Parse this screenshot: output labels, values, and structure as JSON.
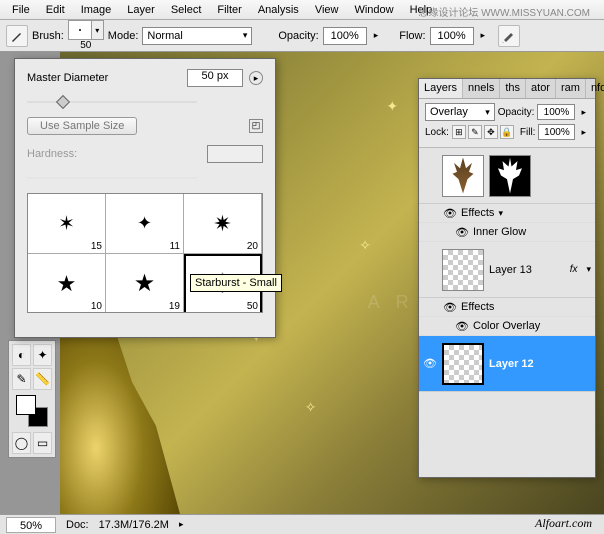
{
  "menu": [
    "File",
    "Edit",
    "Image",
    "Layer",
    "Select",
    "Filter",
    "Analysis",
    "View",
    "Window",
    "Help"
  ],
  "watermark": "思缘设计论坛  WWW.MISSYUAN.COM",
  "options": {
    "brush_label": "Brush:",
    "brush_size": "50",
    "mode_label": "Mode:",
    "mode_value": "Normal",
    "opacity_label": "Opacity:",
    "opacity_value": "100%",
    "flow_label": "Flow:",
    "flow_value": "100%"
  },
  "brush_panel": {
    "diameter_label": "Master Diameter",
    "diameter_value": "50 px",
    "sample_btn": "Use Sample Size",
    "hardness_label": "Hardness:",
    "hardness_value": "",
    "cells": [
      {
        "n": "15"
      },
      {
        "n": "11"
      },
      {
        "n": "20"
      },
      {
        "n": "10"
      },
      {
        "n": "19"
      },
      {
        "n": "50"
      }
    ],
    "tooltip": "Starburst - Small"
  },
  "layers": {
    "tabs": [
      "Layers",
      "nnels",
      "ths",
      "ator",
      "ram",
      "nfo"
    ],
    "blend": "Overlay",
    "opacity_label": "Opacity:",
    "opacity_value": "100%",
    "lock_label": "Lock:",
    "fill_label": "Fill:",
    "fill_value": "100%",
    "effects_label": "Effects",
    "inner_glow": "Inner Glow",
    "layer13": "Layer 13",
    "color_overlay": "Color Overlay",
    "layer12": "Layer 12"
  },
  "status": {
    "zoom": "50%",
    "doc_label": "Doc:",
    "doc_value": "17.3M/176.2M"
  },
  "canvas_text": "A R T .",
  "alfoa": "Alfoart.com"
}
